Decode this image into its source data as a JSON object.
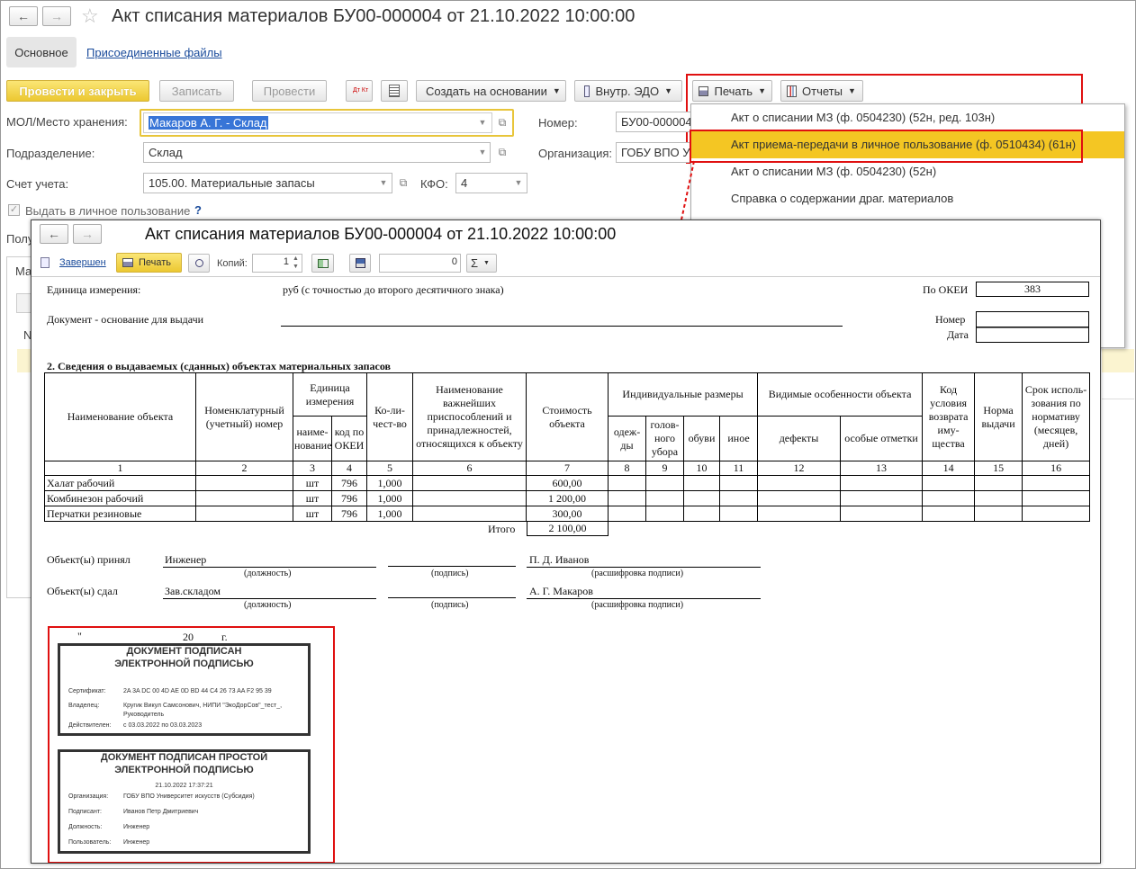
{
  "window": {
    "title": "Акт списания материалов БУ00-000004 от 21.10.2022 10:00:00",
    "tabs": [
      "Основное",
      "Присоединенные файлы"
    ]
  },
  "toolbar": {
    "post_close": "Провести и закрыть",
    "save": "Записать",
    "post": "Провести",
    "dtkt_icon": "Дт Кт",
    "create_based": "Создать на основании",
    "edo": "Внутр. ЭДО",
    "print": "Печать",
    "reports": "Отчеты"
  },
  "form": {
    "mol_label": "МОЛ/Место хранения:",
    "mol_value": "Макаров А. Г. - Склад",
    "dept_label": "Подразделение:",
    "dept_value": "Склад",
    "account_label": "Счет учета:",
    "account_value": "105.00. Материальные запасы",
    "kfo_label": "КФО:",
    "kfo_value": "4",
    "number_label": "Номер:",
    "number_value": "БУ00-000004",
    "org_label": "Организация:",
    "org_value": "ГОБУ ВПО Уни",
    "checkbox_label": "Выдать в личное пользование",
    "help": "?",
    "partial_label": "Полу",
    "partial_tab": "Ма",
    "partial_col": "N"
  },
  "print_menu": {
    "items": [
      "Акт о списании МЗ (ф. 0504230) (52н, ред. 103н)",
      "Акт приема-передачи в личное пользование (ф. 0510434) (61н)",
      "Акт о списании МЗ (ф. 0504230) (52н)",
      "Справка о содержании драг. материалов"
    ]
  },
  "preview": {
    "title": "Акт списания материалов БУ00-000004 от 21.10.2022 10:00:00",
    "status_link": "Завершен",
    "print_btn": "Печать",
    "copies_label": "Копий:",
    "copies_value": "1",
    "sum_value": "0",
    "sigma": "Σ"
  },
  "doc": {
    "unit_label": "Единица измерения:",
    "unit_value": "руб (с точностью до второго десятичного знака)",
    "okei_label": "По ОКЕИ",
    "okei_value": "383",
    "basis_label": "Документ - основание для выдачи",
    "number_label": "Номер",
    "date_label": "Дата",
    "section_title": "2. Сведения о выдаваемых (сданных) объектах материальных запасов",
    "headers": {
      "name": "Наименование объекта",
      "nomen": "Номенклатурный (учетный) номер",
      "unit": "Единица измерения",
      "unit_name": "наиме-нование",
      "unit_code": "код по ОКЕИ",
      "qty": "Ко-ли-чест-во",
      "accessories": "Наименование важнейших приспособлений и принадлежностей, относящихся к объекту",
      "cost": "Стоимость объекта",
      "sizes": "Индивидуальные размеры",
      "size_clothes": "одеж-ды",
      "size_hat": "голов-ного убора",
      "size_shoes": "обуви",
      "size_other": "иное",
      "visible": "Видимые особенности объекта",
      "defects": "дефекты",
      "marks": "особые отметки",
      "return_code": "Код условия возврата иму-щества",
      "norm": "Норма выдачи",
      "term": "Срок исполь-зования по нормативу (месяцев, дней)"
    },
    "col_numbers": [
      "1",
      "2",
      "3",
      "4",
      "5",
      "6",
      "7",
      "8",
      "9",
      "10",
      "11",
      "12",
      "13",
      "14",
      "15",
      "16"
    ],
    "rows": [
      {
        "name": "Халат рабочий",
        "unit": "шт",
        "code": "796",
        "qty": "1,000",
        "cost": "600,00"
      },
      {
        "name": "Комбинезон рабочий",
        "unit": "шт",
        "code": "796",
        "qty": "1,000",
        "cost": "1 200,00"
      },
      {
        "name": "Перчатки резиновые",
        "unit": "шт",
        "code": "796",
        "qty": "1,000",
        "cost": "300,00"
      }
    ],
    "total_label": "Итого",
    "total_value": "2 100,00",
    "accepted_label": "Объект(ы) принял",
    "accepted_position": "Инженер",
    "accepted_name": "П. Д. Иванов",
    "handed_label": "Объект(ы) сдал",
    "handed_position": "Зав.складом",
    "handed_name": "А. Г. Макаров",
    "cap_position": "(должность)",
    "cap_sign": "(подпись)",
    "cap_decode": "(расшифровка подписи)",
    "date_quote": "\"",
    "date_year": "20",
    "date_g": "г."
  },
  "stamp1": {
    "title1": "ДОКУМЕНТ ПОДПИСАН",
    "title2": "ЭЛЕКТРОННОЙ ПОДПИСЬЮ",
    "cert_label": "Сертификат:",
    "cert_value": "2A 3A DC 00 4D AE 0D BD 44 C4 26 73 AA F2 95 39",
    "owner_label": "Владелец:",
    "owner_value1": "Кругик Викул Самсонович, НИПИ \"ЭкоДорСов\"_тест_,",
    "owner_value2": "Руководитель",
    "valid_label": "Действителен:",
    "valid_value": "с 03.03.2022 по 03.03.2023"
  },
  "stamp2": {
    "title1": "ДОКУМЕНТ ПОДПИСАН ПРОСТОЙ",
    "title2": "ЭЛЕКТРОННОЙ ПОДПИСЬЮ",
    "datetime": "21.10.2022 17:37:21",
    "org_label": "Организация:",
    "org_value": "ГОБУ ВПО Университет искусств (Субсидия)",
    "signer_label": "Подписант:",
    "signer_value": "Иванов Петр Дмитриевич",
    "position_label": "Должность:",
    "position_value": "Инженер",
    "user_label": "Пользователь:",
    "user_value": "Инженер"
  }
}
